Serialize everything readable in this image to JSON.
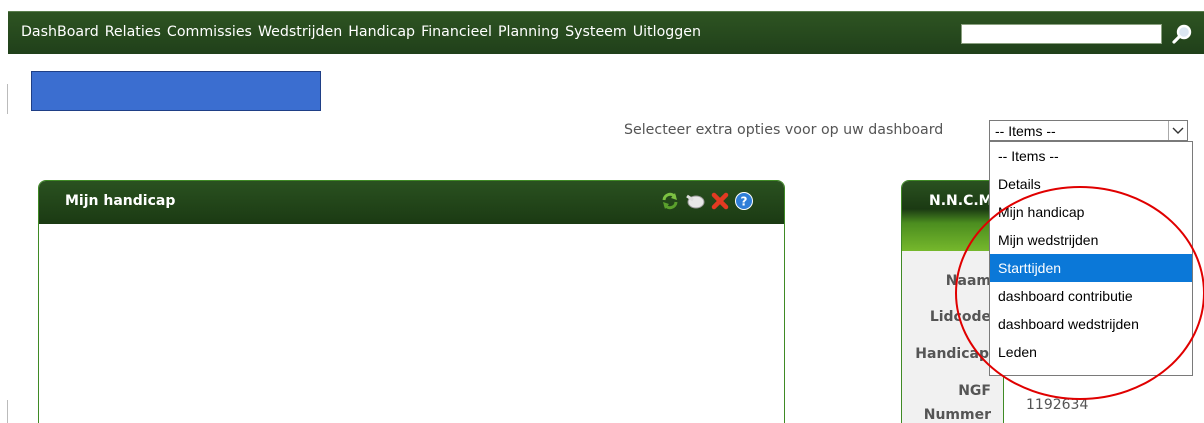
{
  "nav": {
    "items": [
      "DashBoard",
      "Relaties",
      "Commissies",
      "Wedstrijden",
      "Handicap",
      "Financieel",
      "Planning",
      "Systeem",
      "Uitloggen"
    ],
    "search_value": "",
    "search_icon": "magnifier-icon"
  },
  "dashboard": {
    "options_label": "Selecteer extra opties voor op uw dashboard",
    "select_value": "-- Items --",
    "options": [
      "-- Items --",
      "Details",
      "Mijn handicap",
      "Mijn wedstrijden",
      "Starttijden",
      "dashboard contributie",
      "dashboard wedstrijden",
      "Leden"
    ],
    "highlighted_option": "Starttijden"
  },
  "widget_handicap": {
    "title": "Mijn handicap",
    "icons": [
      "refresh-icon",
      "minimize-icon",
      "close-icon",
      "help-icon"
    ]
  },
  "widget_ncm": {
    "title": "N.N.C.M",
    "labels": [
      "Naam",
      "Lidcode",
      "Handicap",
      "NGF",
      "Nummer"
    ],
    "ngf_number": "1192634"
  },
  "colors": {
    "nav_green": "#20401a",
    "accent_blue": "#3b6ed0",
    "selected_blue": "#0b78d8",
    "highlight_red": "#e00000"
  }
}
